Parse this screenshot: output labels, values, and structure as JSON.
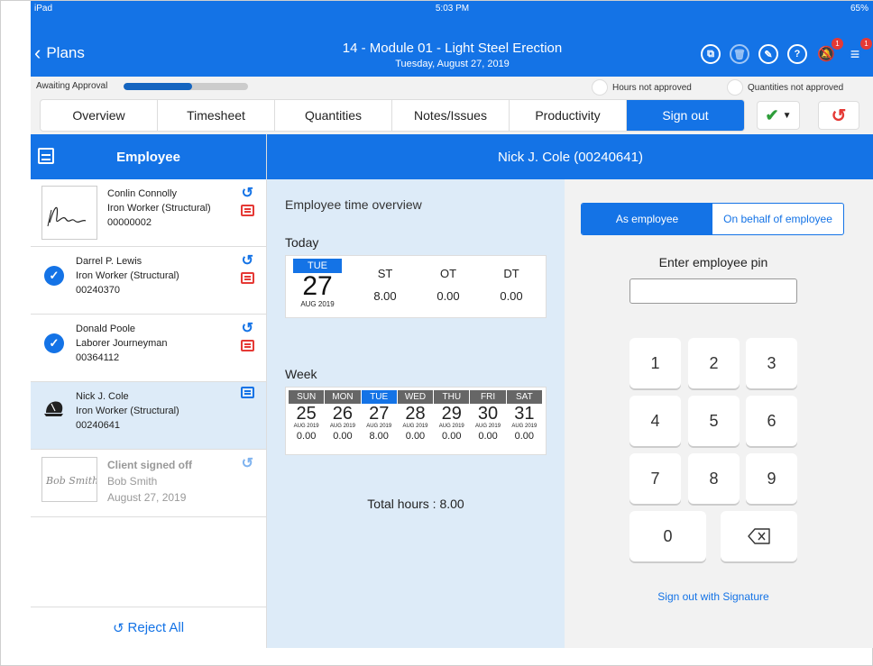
{
  "status": {
    "device": "iPad",
    "time": "5:03 PM",
    "battery": "65%"
  },
  "nav": {
    "back_label": "Plans",
    "title": "14 - Module 01 - Light Steel Erection",
    "subtitle": "Tuesday, August 27, 2019",
    "notification_badge": "1",
    "menu_badge": "1"
  },
  "approval": {
    "label": "Awaiting Approval",
    "progress": 0.55,
    "hours_legend": "Hours not approved",
    "quantities_legend": "Quantities not approved"
  },
  "tabs": [
    {
      "label": "Overview"
    },
    {
      "label": "Timesheet"
    },
    {
      "label": "Quantities"
    },
    {
      "label": "Notes/Issues"
    },
    {
      "label": "Productivity"
    },
    {
      "label": "Sign out"
    }
  ],
  "left": {
    "header": "Employee",
    "employees": [
      {
        "name": "Conlin Connolly",
        "role": "Iron Worker (Structural)",
        "id": "00000002"
      },
      {
        "name": "Darrel P. Lewis",
        "role": "Iron Worker (Structural)",
        "id": "00240370"
      },
      {
        "name": "Donald Poole",
        "role": "Laborer Journeyman",
        "id": "00364112"
      },
      {
        "name": "Nick J. Cole",
        "role": "Iron Worker (Structural)",
        "id": "00240641"
      }
    ],
    "client": {
      "status": "Client signed off",
      "name": "Bob Smith",
      "date": "August 27, 2019",
      "signature": "Bob Smith"
    },
    "reject_all": "Reject All"
  },
  "right": {
    "header": "Nick J. Cole (00240641)",
    "overview_title": "Employee time overview",
    "today_label": "Today",
    "today": {
      "dow": "TUE",
      "day": "27",
      "month_year": "AUG 2019",
      "cols": [
        {
          "h": "ST",
          "v": "8.00"
        },
        {
          "h": "OT",
          "v": "0.00"
        },
        {
          "h": "DT",
          "v": "0.00"
        }
      ]
    },
    "week_label": "Week",
    "week": [
      {
        "dow": "SUN",
        "day": "25",
        "my": "AUG 2019",
        "hrs": "0.00"
      },
      {
        "dow": "MON",
        "day": "26",
        "my": "AUG 2019",
        "hrs": "0.00"
      },
      {
        "dow": "TUE",
        "day": "27",
        "my": "AUG 2019",
        "hrs": "8.00"
      },
      {
        "dow": "WED",
        "day": "28",
        "my": "AUG 2019",
        "hrs": "0.00"
      },
      {
        "dow": "THU",
        "day": "29",
        "my": "AUG 2019",
        "hrs": "0.00"
      },
      {
        "dow": "FRI",
        "day": "30",
        "my": "AUG 2019",
        "hrs": "0.00"
      },
      {
        "dow": "SAT",
        "day": "31",
        "my": "AUG 2019",
        "hrs": "0.00"
      }
    ],
    "total": "Total hours : 8.00",
    "seg_employee": "As employee",
    "seg_behalf": "On behalf of employee",
    "pin_label": "Enter employee pin",
    "keys": [
      "1",
      "2",
      "3",
      "4",
      "5",
      "6",
      "7",
      "8",
      "9",
      "0"
    ],
    "sign_link": "Sign out with Signature"
  },
  "colors": {
    "accent": "#1473e6",
    "danger": "#e53935",
    "success": "#2e9e3a"
  }
}
